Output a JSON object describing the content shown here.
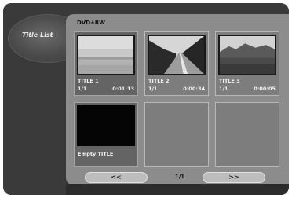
{
  "menu": {
    "label": "Title List"
  },
  "disc": {
    "type": "DVD+RW"
  },
  "titles": [
    {
      "name": "TITLE 1",
      "chapters": "1/1",
      "duration": "0:01:13",
      "thumb": "sea-horizon"
    },
    {
      "name": "TITLE 2",
      "chapters": "1/1",
      "duration": "0:00:34",
      "thumb": "road-with-trees"
    },
    {
      "name": "TITLE 3",
      "chapters": "1/1",
      "duration": "0:00:05",
      "thumb": "mountain-lake"
    }
  ],
  "empty_slot": {
    "label": "Empty TITLE"
  },
  "pagination": {
    "prev": "<<",
    "current": "1/1",
    "next": ">>"
  }
}
